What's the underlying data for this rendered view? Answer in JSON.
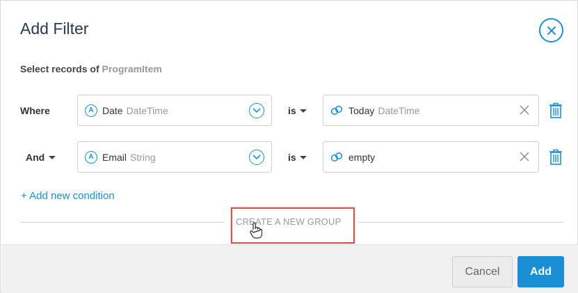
{
  "dialog": {
    "title": "Add Filter",
    "subtitle_prefix": "Select records of",
    "entity": "ProgramItem"
  },
  "conditions": [
    {
      "label": "Where",
      "field_type_icon": "A",
      "field_name": "Date",
      "field_type": "DateTime",
      "operator": "is",
      "value": "Today",
      "value_type": "DateTime"
    },
    {
      "label": "And",
      "field_type_icon": "A",
      "field_name": "Email",
      "field_type": "String",
      "operator": "is",
      "value": "empty",
      "value_type": ""
    }
  ],
  "add_condition_label": "+ Add new condition",
  "create_group_label": "CREATE A NEW GROUP",
  "footer": {
    "cancel_label": "Cancel",
    "add_label": "Add"
  },
  "colors": {
    "accent": "#1a8fd6",
    "highlight": "#e04b4b"
  }
}
